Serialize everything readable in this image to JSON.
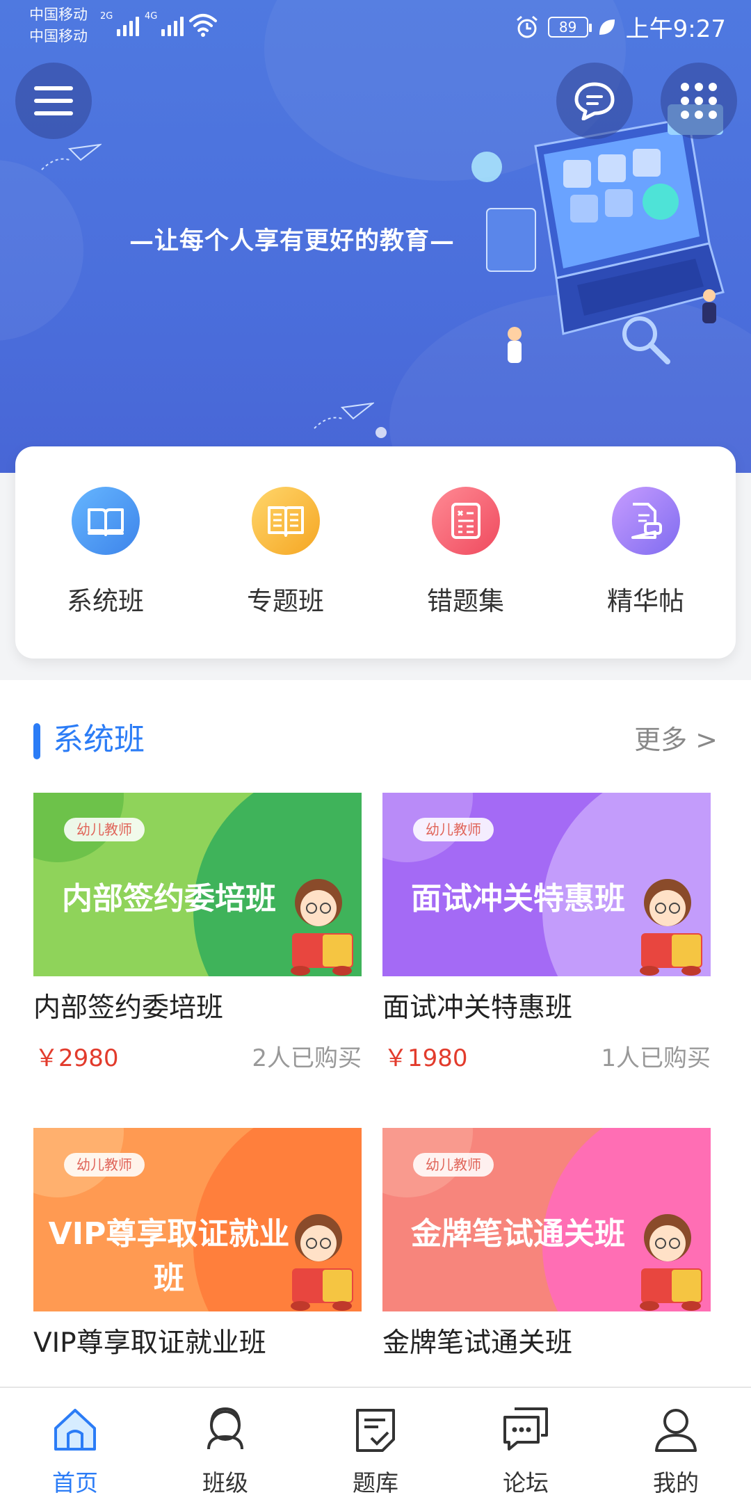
{
  "status_bar": {
    "carrier_1": "中国移动",
    "carrier_2": "中国移动",
    "signal_1_label": "2G",
    "signal_2_label": "4G",
    "battery": "89",
    "time": "上午9:27"
  },
  "banner": {
    "slogan": "—让每个人享有更好的教育—",
    "slides_total": 1,
    "active_slide": 1
  },
  "quick_nav": [
    {
      "label": "系统班",
      "icon": "open-book-icon",
      "color": "#4f9cf2"
    },
    {
      "label": "专题班",
      "icon": "book-icon",
      "color": "#f7b93c"
    },
    {
      "label": "错题集",
      "icon": "clipboard-icon",
      "color": "#f45f6e"
    },
    {
      "label": "精华帖",
      "icon": "document-edit-icon",
      "color": "#9a7cf4"
    }
  ],
  "section": {
    "title": "系统班",
    "more": "更多  >"
  },
  "courses": [
    {
      "tag": "幼儿教师",
      "banner_text": "内部签约委培班",
      "title": "内部签约委培班",
      "price": "￥2980",
      "buyers": "2人已购买",
      "theme": "green"
    },
    {
      "tag": "幼儿教师",
      "banner_text": "面试冲关特惠班",
      "title": "面试冲关特惠班",
      "price": "￥1980",
      "buyers": "1人已购买",
      "theme": "purple"
    },
    {
      "tag": "幼儿教师",
      "banner_text": "VIP尊享取证就业班",
      "title": "VIP尊享取证就业班",
      "price": "",
      "buyers": "",
      "theme": "orange"
    },
    {
      "tag": "幼儿教师",
      "banner_text": "金牌笔试通关班",
      "title": "金牌笔试通关班",
      "price": "",
      "buyers": "",
      "theme": "pink"
    }
  ],
  "tabs": [
    {
      "label": "首页",
      "icon": "home-icon",
      "active": true
    },
    {
      "label": "班级",
      "icon": "class-icon",
      "active": false
    },
    {
      "label": "题库",
      "icon": "question-bank-icon",
      "active": false
    },
    {
      "label": "论坛",
      "icon": "forum-icon",
      "active": false
    },
    {
      "label": "我的",
      "icon": "profile-icon",
      "active": false
    }
  ],
  "colors": {
    "accent": "#2b7cf6",
    "price": "#e23b2c",
    "banner": "#4b6fdc"
  }
}
